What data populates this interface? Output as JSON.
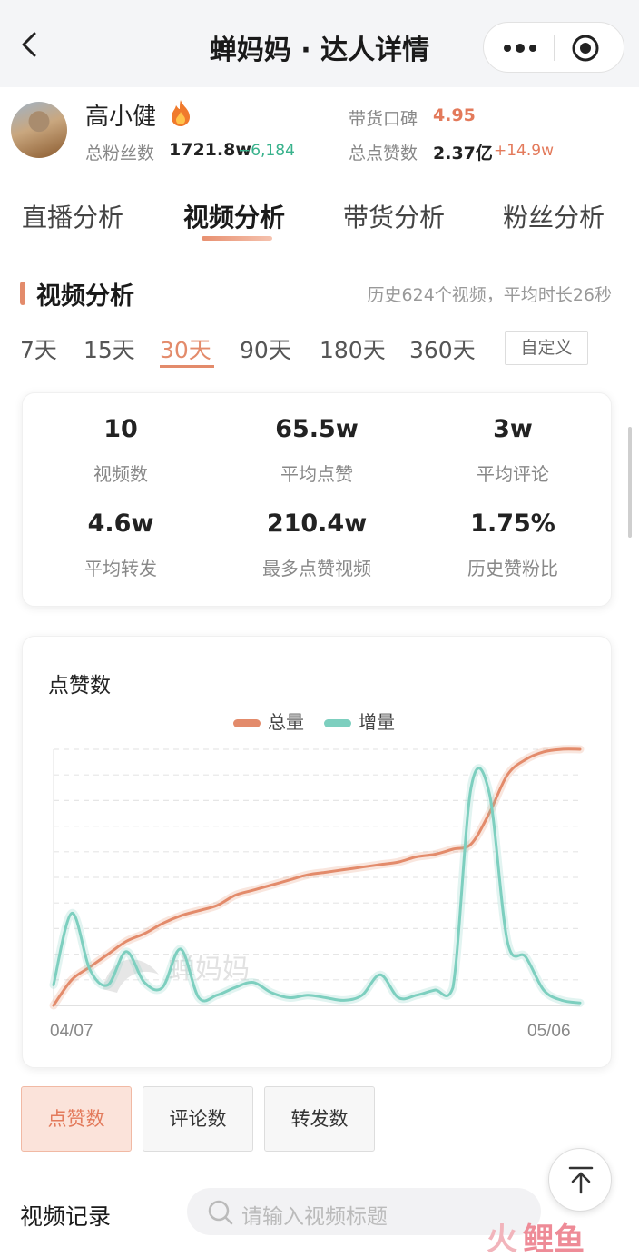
{
  "nav": {
    "title": "蝉妈妈 · 达人详情"
  },
  "profile": {
    "name": "高小健",
    "fans_label": "总粉丝数",
    "fans_value": "1721.8w",
    "fans_delta": "−6,184",
    "rating_label": "带货口碑",
    "rating_value": "4.95",
    "likes_label": "总点赞数",
    "likes_value": "2.37亿",
    "likes_delta": "+14.9w"
  },
  "tabs": [
    {
      "label": "直播分析",
      "active": false
    },
    {
      "label": "视频分析",
      "active": true
    },
    {
      "label": "带货分析",
      "active": false
    },
    {
      "label": "粉丝分析",
      "active": false
    }
  ],
  "section": {
    "title": "视频分析",
    "subtitle": "历史624个视频，平均时长26秒"
  },
  "ranges": [
    {
      "label": "7天",
      "active": false
    },
    {
      "label": "15天",
      "active": false
    },
    {
      "label": "30天",
      "active": true
    },
    {
      "label": "90天",
      "active": false
    },
    {
      "label": "180天",
      "active": false
    },
    {
      "label": "360天",
      "active": false
    }
  ],
  "custom_label": "自定义",
  "metrics": [
    {
      "value": "10",
      "label": "视频数"
    },
    {
      "value": "65.5w",
      "label": "平均点赞"
    },
    {
      "value": "3w",
      "label": "平均评论"
    },
    {
      "value": "4.6w",
      "label": "平均转发"
    },
    {
      "value": "210.4w",
      "label": "最多点赞视频"
    },
    {
      "value": "1.75%",
      "label": "历史赞粉比"
    }
  ],
  "chart_data": {
    "type": "line",
    "title": "点赞数",
    "watermark": "蝉妈妈",
    "x_labels": [
      "04/07",
      "05/06"
    ],
    "x": [
      "04/07",
      "04/08",
      "04/09",
      "04/10",
      "04/11",
      "04/12",
      "04/13",
      "04/14",
      "04/15",
      "04/16",
      "04/17",
      "04/18",
      "04/19",
      "04/20",
      "04/21",
      "04/22",
      "04/23",
      "04/24",
      "04/25",
      "04/26",
      "04/27",
      "04/28",
      "04/29",
      "04/30",
      "05/01",
      "05/02",
      "05/03",
      "05/04",
      "05/05",
      "05/06"
    ],
    "ylim": [
      0,
      100
    ],
    "grid": true,
    "legend_position": "top-center",
    "series": [
      {
        "name": "总量",
        "color": "#e38b6b",
        "values": [
          0,
          10,
          15,
          20,
          25,
          28,
          32,
          35,
          37,
          39,
          43,
          45,
          47,
          49,
          51,
          52,
          53,
          54,
          55,
          56,
          58,
          59,
          61,
          63,
          75,
          90,
          96,
          99,
          100,
          100
        ]
      },
      {
        "name": "增量",
        "color": "#7dcfbf",
        "values": [
          8,
          36,
          14,
          8,
          21,
          9,
          7,
          22,
          3,
          4,
          7,
          9,
          5,
          3,
          4,
          3,
          2,
          4,
          12,
          3,
          4,
          6,
          7,
          85,
          83,
          25,
          19,
          6,
          2,
          1
        ]
      }
    ]
  },
  "metric_buttons": [
    {
      "label": "点赞数",
      "active": true
    },
    {
      "label": "评论数",
      "active": false
    },
    {
      "label": "转发数",
      "active": false
    }
  ],
  "records": {
    "title": "视频记录",
    "search_placeholder": "请输入视频标题"
  },
  "brand_watermark": "鲤鱼",
  "colors": {
    "accent": "#e38b6b",
    "teal": "#7dcfbf",
    "delta_down": "#38b28c",
    "delta_up": "#e37a5b"
  }
}
